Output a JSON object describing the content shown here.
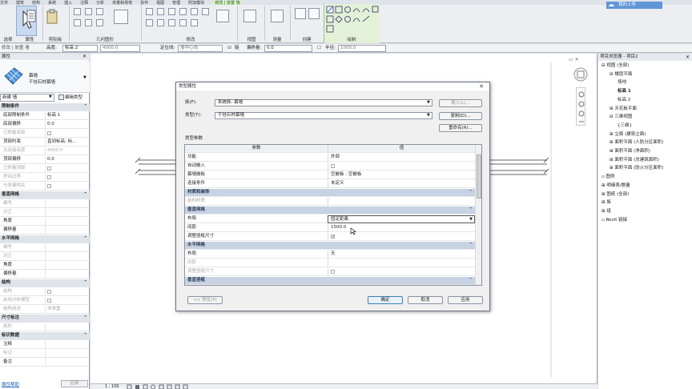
{
  "ribbon": {
    "menu_items": [
      "文件",
      "建筑",
      "结构",
      "系统",
      "插入",
      "注释",
      "分析",
      "体量和场地",
      "协作",
      "视图",
      "管理",
      "附加模块",
      "修改 | 放置 墙"
    ],
    "panels": {
      "select": "选择",
      "properties": "属性",
      "clipboard": "剪贴板",
      "geometry": "几何图形",
      "modify": "修改",
      "view": "视图",
      "measure": "测量",
      "create": "创建",
      "draw": "绘制"
    },
    "login": "我的上传"
  },
  "options_bar": {
    "mode": "修改 | 放置 墙",
    "height_label": "高度:",
    "height_value": "标高 2",
    "height_offset": "4000.0",
    "location_label": "定位线:",
    "location_value": "墙中心线",
    "chain_label": "链",
    "offset_label": "偏移量:",
    "offset_value": "0.0",
    "radius_label": "半径:",
    "radius_value": "1000.0"
  },
  "properties": {
    "header": "属性",
    "family": "幕墙",
    "type": "干挂石材幕墙",
    "instance_selector": "新建 墙",
    "edit_type": "编辑类型",
    "rows": [
      {
        "k": "限制条件",
        "v": "",
        "grp": true
      },
      {
        "k": "底部限制条件",
        "v": "标高 1"
      },
      {
        "k": "底部偏移",
        "v": "0.0"
      },
      {
        "k": "已附着底部",
        "v": "",
        "chk": true,
        "dim": true
      },
      {
        "k": "顶部约束",
        "v": "直到标高: 标..."
      },
      {
        "k": "无连接高度",
        "v": "4000.0",
        "dim": true
      },
      {
        "k": "顶部偏移",
        "v": "0.0"
      },
      {
        "k": "已附着顶部",
        "v": "",
        "chk": true,
        "dim": true
      },
      {
        "k": "房间边界",
        "v": "",
        "chk": true,
        "dim": true
      },
      {
        "k": "与体量相关",
        "v": "",
        "chk": true,
        "dim": true
      },
      {
        "k": "垂直网格",
        "v": "",
        "grp": true
      },
      {
        "k": "编号",
        "v": "",
        "dim": true
      },
      {
        "k": "对正",
        "v": "",
        "dim": true
      },
      {
        "k": "角度",
        "v": ""
      },
      {
        "k": "偏移量",
        "v": ""
      },
      {
        "k": "水平网格",
        "v": "",
        "grp": true
      },
      {
        "k": "编号",
        "v": "",
        "dim": true
      },
      {
        "k": "对正",
        "v": "",
        "dim": true
      },
      {
        "k": "角度",
        "v": ""
      },
      {
        "k": "偏移量",
        "v": ""
      },
      {
        "k": "结构",
        "v": "",
        "grp": true
      },
      {
        "k": "结构",
        "v": "",
        "chk": true,
        "dim": true
      },
      {
        "k": "启用分析模型",
        "v": "",
        "chk": true,
        "dim": true
      },
      {
        "k": "结构用途",
        "v": "非承重",
        "dim": true
      },
      {
        "k": "尺寸标注",
        "v": "",
        "grp": true
      },
      {
        "k": "面积",
        "v": "",
        "dim": true
      },
      {
        "k": "标识数据",
        "v": "",
        "grp": true
      },
      {
        "k": "注释",
        "v": ""
      },
      {
        "k": "标记",
        "v": "",
        "dim": true
      },
      {
        "k": "备注",
        "v": ""
      }
    ],
    "help_link": "属性帮助",
    "apply": "应用"
  },
  "browser": {
    "header": "项目浏览器 - 项目2",
    "items": [
      {
        "t": "视图 (全部)",
        "lvl": 0,
        "icon": "⊟"
      },
      {
        "t": "楼层平面",
        "lvl": 1,
        "icon": "⊟"
      },
      {
        "t": "场地",
        "lvl": 2
      },
      {
        "t": "标高 1",
        "lvl": 2,
        "sel": true
      },
      {
        "t": "标高 2",
        "lvl": 2
      },
      {
        "t": "天花板平面",
        "lvl": 1,
        "icon": "⊞"
      },
      {
        "t": "三维视图",
        "lvl": 1,
        "icon": "⊟"
      },
      {
        "t": "{三维}",
        "lvl": 2
      },
      {
        "t": "立面 (建筑立面)",
        "lvl": 1,
        "icon": "⊞"
      },
      {
        "t": "面积平面 (人防分区面积)",
        "lvl": 1,
        "icon": "⊞"
      },
      {
        "t": "面积平面 (净面积)",
        "lvl": 1,
        "icon": "⊞"
      },
      {
        "t": "面积平面 (总建筑面积)",
        "lvl": 1,
        "icon": "⊞"
      },
      {
        "t": "面积平面 (防火分区面积)",
        "lvl": 1,
        "icon": "⊞"
      },
      {
        "t": "图例",
        "lvl": 0,
        "icon": ""
      },
      {
        "t": "明细表/数量",
        "lvl": 0,
        "icon": "⊞"
      },
      {
        "t": "图纸 (全部)",
        "lvl": 0,
        "icon": "⊞"
      },
      {
        "t": "族",
        "lvl": 0,
        "icon": "⊞"
      },
      {
        "t": "组",
        "lvl": 0,
        "icon": "⊞"
      },
      {
        "t": "Revit 链接",
        "lvl": 0,
        "icon": ""
      }
    ]
  },
  "dialog": {
    "title": "类型属性",
    "close": "✕",
    "family_label": "族(F):",
    "family_value": "系统族: 幕墙",
    "type_label": "类型(T):",
    "type_value": "干挂石材幕墙",
    "load_btn": "载入(L)...",
    "duplicate_btn": "复制(D)...",
    "rename_btn": "重命名(R)...",
    "params_label": "类型参数",
    "col_param": "参数",
    "col_value": "值",
    "rows": [
      {
        "k": "功能",
        "v": "外部"
      },
      {
        "k": "自动嵌入",
        "v": "",
        "chk": true
      },
      {
        "k": "幕墙嵌板",
        "v": "空嵌板 : 空嵌板"
      },
      {
        "k": "连接条件",
        "v": "未定义"
      },
      {
        "k": "材质和装饰",
        "grp": true
      },
      {
        "k": "结构材质",
        "v": "",
        "dim": true
      },
      {
        "k": "垂直网格",
        "grp": true
      },
      {
        "k": "布局",
        "v": "固定距离",
        "combo": true
      },
      {
        "k": "间距",
        "v": "1500.0"
      },
      {
        "k": "调整竖梃尺寸",
        "v": "",
        "chk": true,
        "checked": true
      },
      {
        "k": "水平网格",
        "grp": true
      },
      {
        "k": "布局",
        "v": "无"
      },
      {
        "k": "间距",
        "v": "",
        "dim": true
      },
      {
        "k": "调整竖梃尺寸",
        "v": "",
        "chk": true,
        "dim": true
      },
      {
        "k": "垂直竖梃",
        "grp": true
      }
    ],
    "preview_btn": "<< 预览(P)",
    "ok_btn": "确定",
    "cancel_btn": "取消",
    "apply_btn": "应用"
  },
  "statusbar": {
    "scale": "1 : 100"
  }
}
